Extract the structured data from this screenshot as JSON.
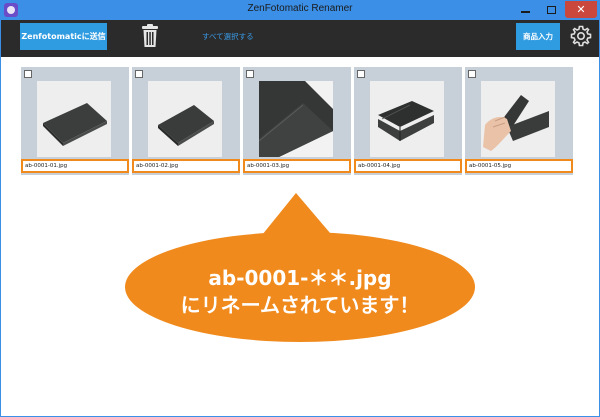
{
  "window": {
    "title": "ZenFotomatic Renamer",
    "accent_color": "#3b8fe6",
    "close_color": "#c9473c"
  },
  "toolbar": {
    "send_label": "Zenfotomaticに送信",
    "delete_icon": "trash-icon",
    "select_all_label": "すべて選択する",
    "product_input_label": "商品入力",
    "settings_icon": "gear-icon",
    "button_color": "#2f9be0"
  },
  "images": [
    {
      "filename": "ab-0001-01.jpg",
      "checked": false,
      "photo": "wallet-closed-angle"
    },
    {
      "filename": "ab-0001-02.jpg",
      "checked": false,
      "photo": "wallet-closed-side"
    },
    {
      "filename": "ab-0001-03.jpg",
      "checked": false,
      "photo": "wallet-closeup"
    },
    {
      "filename": "ab-0001-04.jpg",
      "checked": false,
      "photo": "wallet-open"
    },
    {
      "filename": "ab-0001-05.jpg",
      "checked": false,
      "photo": "wallet-in-hand"
    }
  ],
  "callout": {
    "line1": "ab-0001-＊＊.jpg",
    "line2": "にリネームされています！",
    "color": "#f08a1c"
  }
}
